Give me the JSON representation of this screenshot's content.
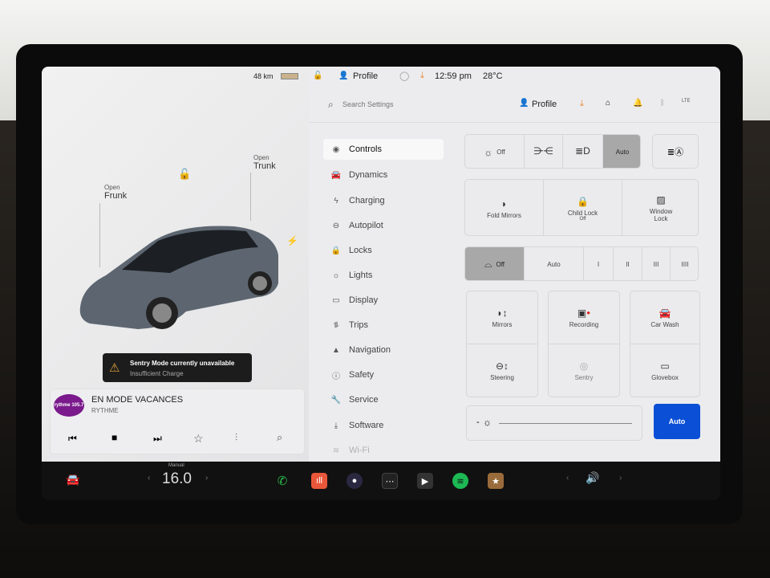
{
  "status": {
    "range": "48 km",
    "profile": "Profile",
    "time": "12:59 pm",
    "temp": "28°C"
  },
  "car": {
    "frunk_state": "Open",
    "frunk_label": "Frunk",
    "trunk_state": "Open",
    "trunk_label": "Trunk"
  },
  "alert": {
    "title": "Sentry Mode currently unavailable",
    "subtitle": "Insufficient Charge"
  },
  "media": {
    "station_logo": "rythme 105.7",
    "title": "EN MODE VACANCES",
    "source": "RYTHME"
  },
  "settings_header": {
    "search_placeholder": "Search Settings",
    "profile": "Profile",
    "signal": "LTE"
  },
  "sidebar": {
    "items": [
      {
        "label": "Controls",
        "icon": "toggle-icon"
      },
      {
        "label": "Dynamics",
        "icon": "car-icon"
      },
      {
        "label": "Charging",
        "icon": "bolt-icon"
      },
      {
        "label": "Autopilot",
        "icon": "steering-wheel-icon"
      },
      {
        "label": "Locks",
        "icon": "lock-icon"
      },
      {
        "label": "Lights",
        "icon": "sun-icon"
      },
      {
        "label": "Display",
        "icon": "display-icon"
      },
      {
        "label": "Trips",
        "icon": "trips-icon"
      },
      {
        "label": "Navigation",
        "icon": "navigation-icon"
      },
      {
        "label": "Safety",
        "icon": "safety-icon"
      },
      {
        "label": "Service",
        "icon": "wrench-icon"
      },
      {
        "label": "Software",
        "icon": "download-icon"
      },
      {
        "label": "Wi-Fi",
        "icon": "wifi-icon"
      }
    ]
  },
  "controls": {
    "lights": {
      "off": "Off",
      "auto": "Auto",
      "selected": "Auto"
    },
    "fold_mirrors": "Fold Mirrors",
    "child_lock": "Child Lock",
    "child_lock_state": "Off",
    "window_lock": "Window Lock",
    "wipers": {
      "off": "Off",
      "auto": "Auto",
      "speeds": [
        "I",
        "II",
        "III",
        "IIII"
      ],
      "selected": "Off"
    },
    "mirrors": "Mirrors",
    "recording": "Recording",
    "car_wash": "Car Wash",
    "steering": "Steering",
    "sentry": "Sentry",
    "glovebox": "Glovebox",
    "brightness": {
      "minus": "-",
      "auto": "Auto",
      "accent": "#0a4fd6"
    }
  },
  "dock": {
    "climate_mode": "Manual",
    "temperature": "16.0"
  }
}
